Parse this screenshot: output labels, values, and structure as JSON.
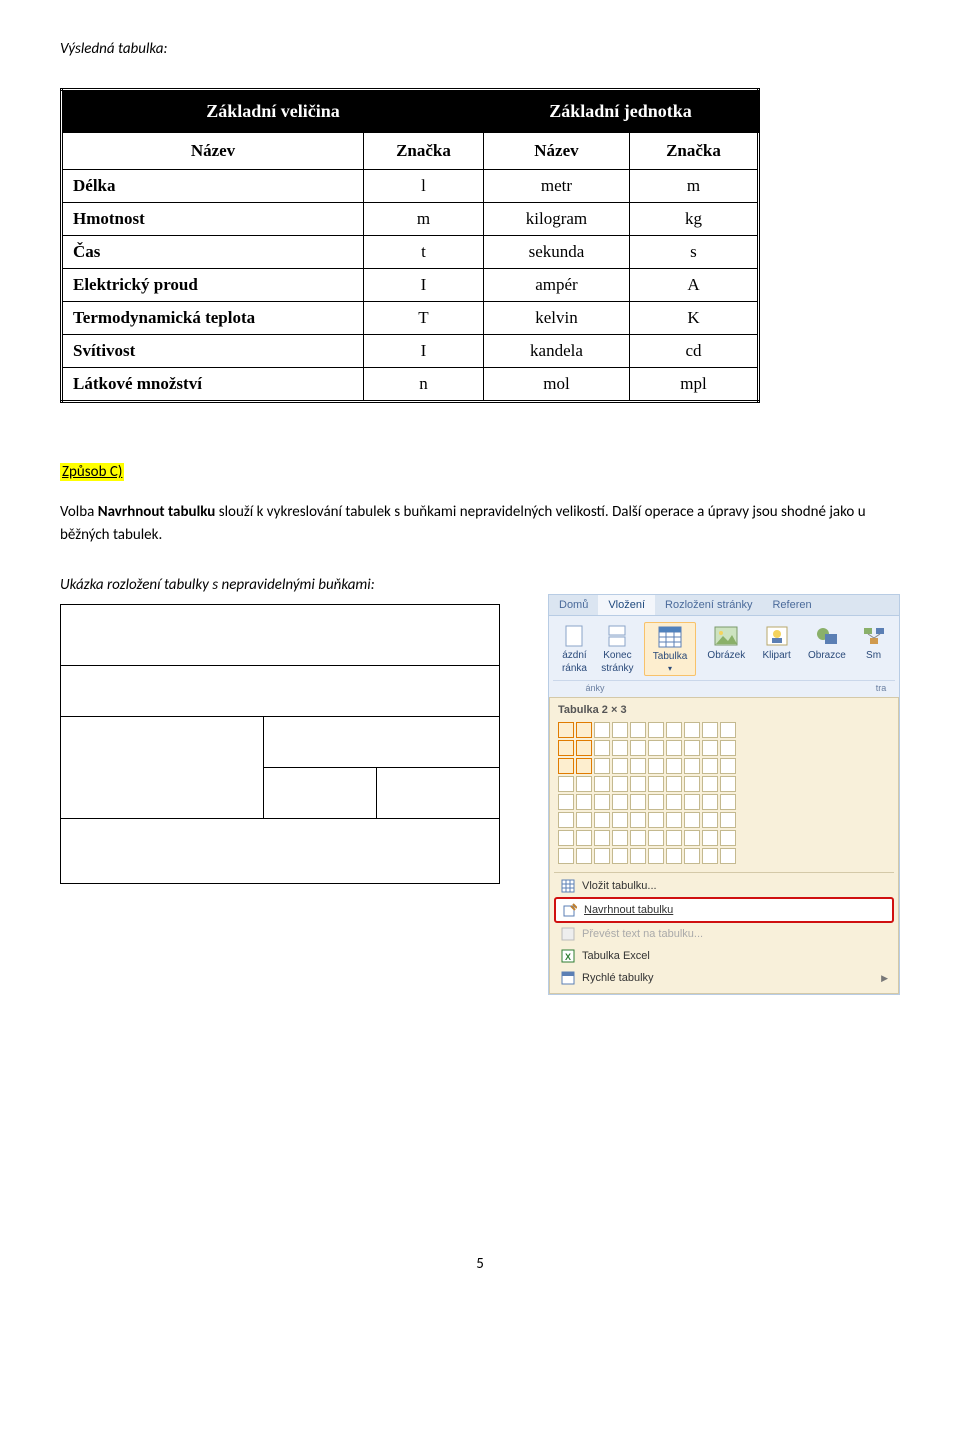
{
  "title": "Výsledná tabulka:",
  "table": {
    "header1": "Základní veličina",
    "header2": "Základní jednotka",
    "sub": [
      "Název",
      "Značka",
      "Název",
      "Značka"
    ],
    "rows": [
      {
        "name": "Délka",
        "sym": "l",
        "unit": "metr",
        "usym": "m"
      },
      {
        "name": "Hmotnost",
        "sym": "m",
        "unit": "kilogram",
        "usym": "kg"
      },
      {
        "name": "Čas",
        "sym": "t",
        "unit": "sekunda",
        "usym": "s"
      },
      {
        "name": "Elektrický proud",
        "sym": "I",
        "unit": "ampér",
        "usym": "A"
      },
      {
        "name": "Termodynamická teplota",
        "sym": "T",
        "unit": "kelvin",
        "usym": "K"
      },
      {
        "name": "Svítivost",
        "sym": "I",
        "unit": "kandela",
        "usym": "cd"
      },
      {
        "name": "Látkové množství",
        "sym": "n",
        "unit": "mol",
        "usym": "mpl"
      }
    ]
  },
  "section_label": "Způsob C)",
  "paragraph_prefix": "Volba ",
  "paragraph_bold": "Navrhnout tabulku",
  "paragraph_rest": " slouží k vykreslování tabulek s buňkami nepravidelných velikostí. Další operace a úpravy jsou shodné jako u běžných tabulek.",
  "caption": "Ukázka rozložení tabulky s nepravidelnými buňkami:",
  "ribbon": {
    "tabs": {
      "home": "Domů",
      "insert": "Vložení",
      "layout": "Rozložení stránky",
      "refer": "Referen"
    },
    "buttons": {
      "blank_page_1": "ázdní",
      "blank_page_2": "ránka",
      "page_break_1": "Konec",
      "page_break_2": "stránky",
      "table": "Tabulka",
      "picture": "Obrázek",
      "clipart": "Klipart",
      "shapes": "Obrazce",
      "smartart": "Sm"
    },
    "group_pages": "ánky",
    "group_illus": "tra",
    "dropdown_title": "Tabulka 2 × 3",
    "menu": {
      "insert_table": "Vložit tabulku...",
      "draw_table": "Navrhnout tabulku",
      "convert": "Převést text na tabulku...",
      "excel": "Tabulka Excel",
      "quick": "Rychlé tabulky"
    }
  },
  "pagenum": "5"
}
